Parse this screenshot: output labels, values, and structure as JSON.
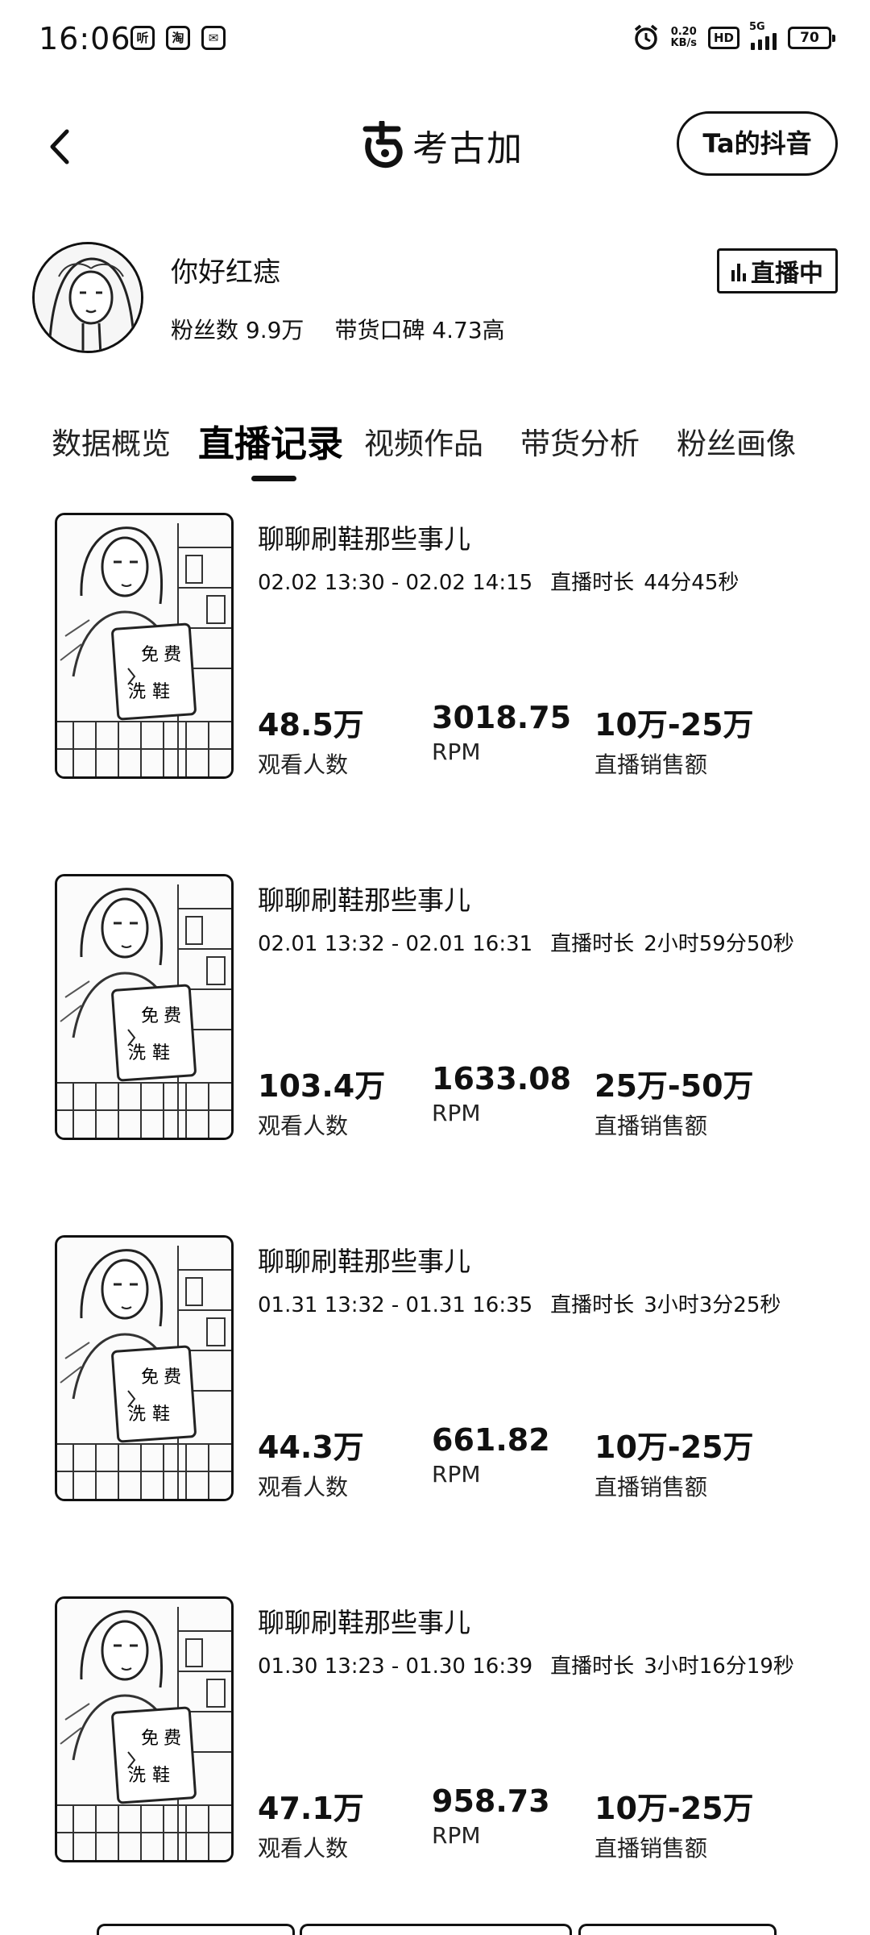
{
  "status_bar": {
    "time": "16:06",
    "app_icons": [
      "听",
      "淘",
      "✉"
    ],
    "net_speed_value": "0.20",
    "net_speed_unit": "KB/s",
    "hd": "HD",
    "network": "5G",
    "battery": "70"
  },
  "header": {
    "brand_name": "考古加",
    "douyin_button": "Ta的抖音"
  },
  "profile": {
    "name": "你好红痣",
    "fans": "粉丝数 9.9万",
    "reputation": "带货口碑 4.73高",
    "live_badge": "直播中"
  },
  "tabs": [
    {
      "label": "数据概览",
      "active": false
    },
    {
      "label": "直播记录",
      "active": true
    },
    {
      "label": "视频作品",
      "active": false
    },
    {
      "label": "带货分析",
      "active": false
    },
    {
      "label": "粉丝画像",
      "active": false
    }
  ],
  "thumbnail_sign": [
    "免",
    "费",
    "洗",
    "鞋"
  ],
  "records": [
    {
      "title": "聊聊刷鞋那些事儿",
      "time_range": "02.02 13:30 - 02.02 14:15",
      "duration_label": "直播时长",
      "duration": "44分45秒",
      "viewers": "48.5万",
      "viewers_label": "观看人数",
      "rpm": "3018.75",
      "rpm_label": "RPM",
      "sales": "10万-25万",
      "sales_label": "直播销售额"
    },
    {
      "title": "聊聊刷鞋那些事儿",
      "time_range": "02.01 13:32 - 02.01 16:31",
      "duration_label": "直播时长",
      "duration": "2小时59分50秒",
      "viewers": "103.4万",
      "viewers_label": "观看人数",
      "rpm": "1633.08",
      "rpm_label": "RPM",
      "sales": "25万-50万",
      "sales_label": "直播销售额"
    },
    {
      "title": "聊聊刷鞋那些事儿",
      "time_range": "01.31 13:32 - 01.31 16:35",
      "duration_label": "直播时长",
      "duration": "3小时3分25秒",
      "viewers": "44.3万",
      "viewers_label": "观看人数",
      "rpm": "661.82",
      "rpm_label": "RPM",
      "sales": "10万-25万",
      "sales_label": "直播销售额"
    },
    {
      "title": "聊聊刷鞋那些事儿",
      "time_range": "01.30 13:23 - 01.30 16:39",
      "duration_label": "直播时长",
      "duration": "3小时16分19秒",
      "viewers": "47.1万",
      "viewers_label": "观看人数",
      "rpm": "958.73",
      "rpm_label": "RPM",
      "sales": "10万-25万",
      "sales_label": "直播销售额"
    }
  ]
}
